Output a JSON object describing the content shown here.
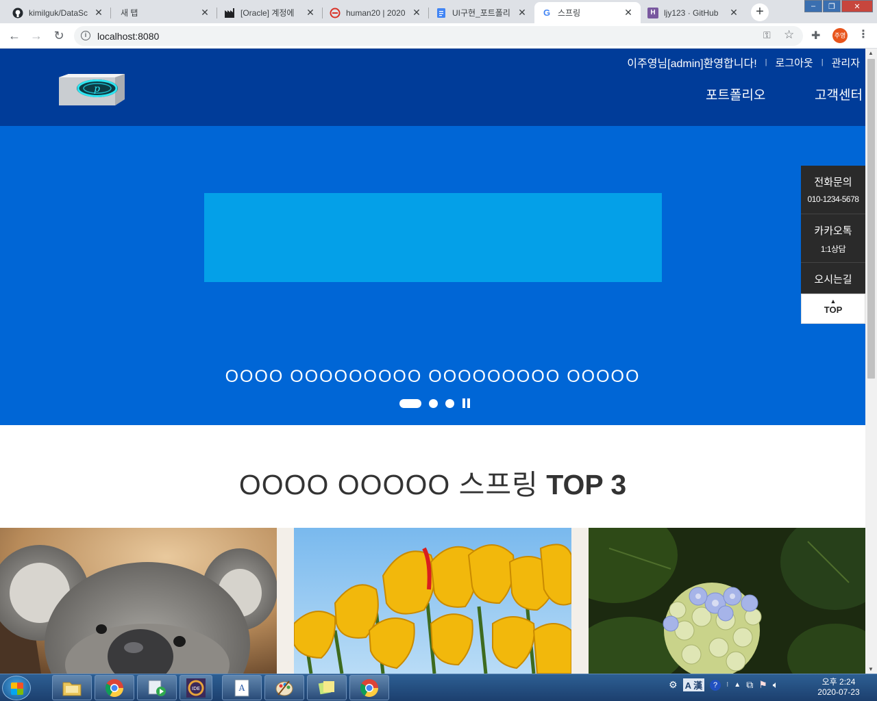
{
  "browser": {
    "tabs": [
      {
        "title": "kimilguk/DataSc",
        "favicon": "github-icon"
      },
      {
        "title": "새 탭",
        "favicon": "none"
      },
      {
        "title": "[Oracle] 계정에",
        "favicon": "factory-icon"
      },
      {
        "title": "human20 | 2020",
        "favicon": "red-circle-icon"
      },
      {
        "title": "UI구현_포트폴리",
        "favicon": "google-docs-icon"
      },
      {
        "title": "스프링",
        "favicon": "google-icon",
        "active": true
      },
      {
        "title": "ljy123 · GitHub",
        "favicon": "heroku-icon"
      }
    ],
    "url": "localhost:8080",
    "profile_initials": "주영"
  },
  "site": {
    "header": {
      "welcome": "이주영님[admin]환영합니다!",
      "logout": "로그아웃",
      "admin": "관리자",
      "nav": [
        "포트폴리오",
        "고객센터"
      ]
    },
    "hero": {
      "caption": "OOOO OOOOOOOOO OOOOOOOOO OOOOO",
      "slides": 3,
      "active_slide": 1
    },
    "quick_menu": {
      "phone_title": "전화문의",
      "phone_number": "010-1234-5678",
      "kakao_title": "카카오톡",
      "kakao_sub": "1:1상담",
      "directions": "오시는길",
      "top": "TOP"
    },
    "section": {
      "title_light": "OOOO OOOOO 스프링",
      "title_bold": "TOP 3"
    },
    "cards": [
      {
        "name": "koala-image"
      },
      {
        "name": "tulips-image"
      },
      {
        "name": "hydrangea-image"
      }
    ]
  },
  "taskbar": {
    "time": "오후 2:24",
    "date": "2020-07-23",
    "ime": "A 漢"
  },
  "colors": {
    "header_bg": "#003c99",
    "hero_bg": "#0066d6",
    "hero_box": "#04a0e8",
    "quick_bg": "#2a2a2a"
  }
}
